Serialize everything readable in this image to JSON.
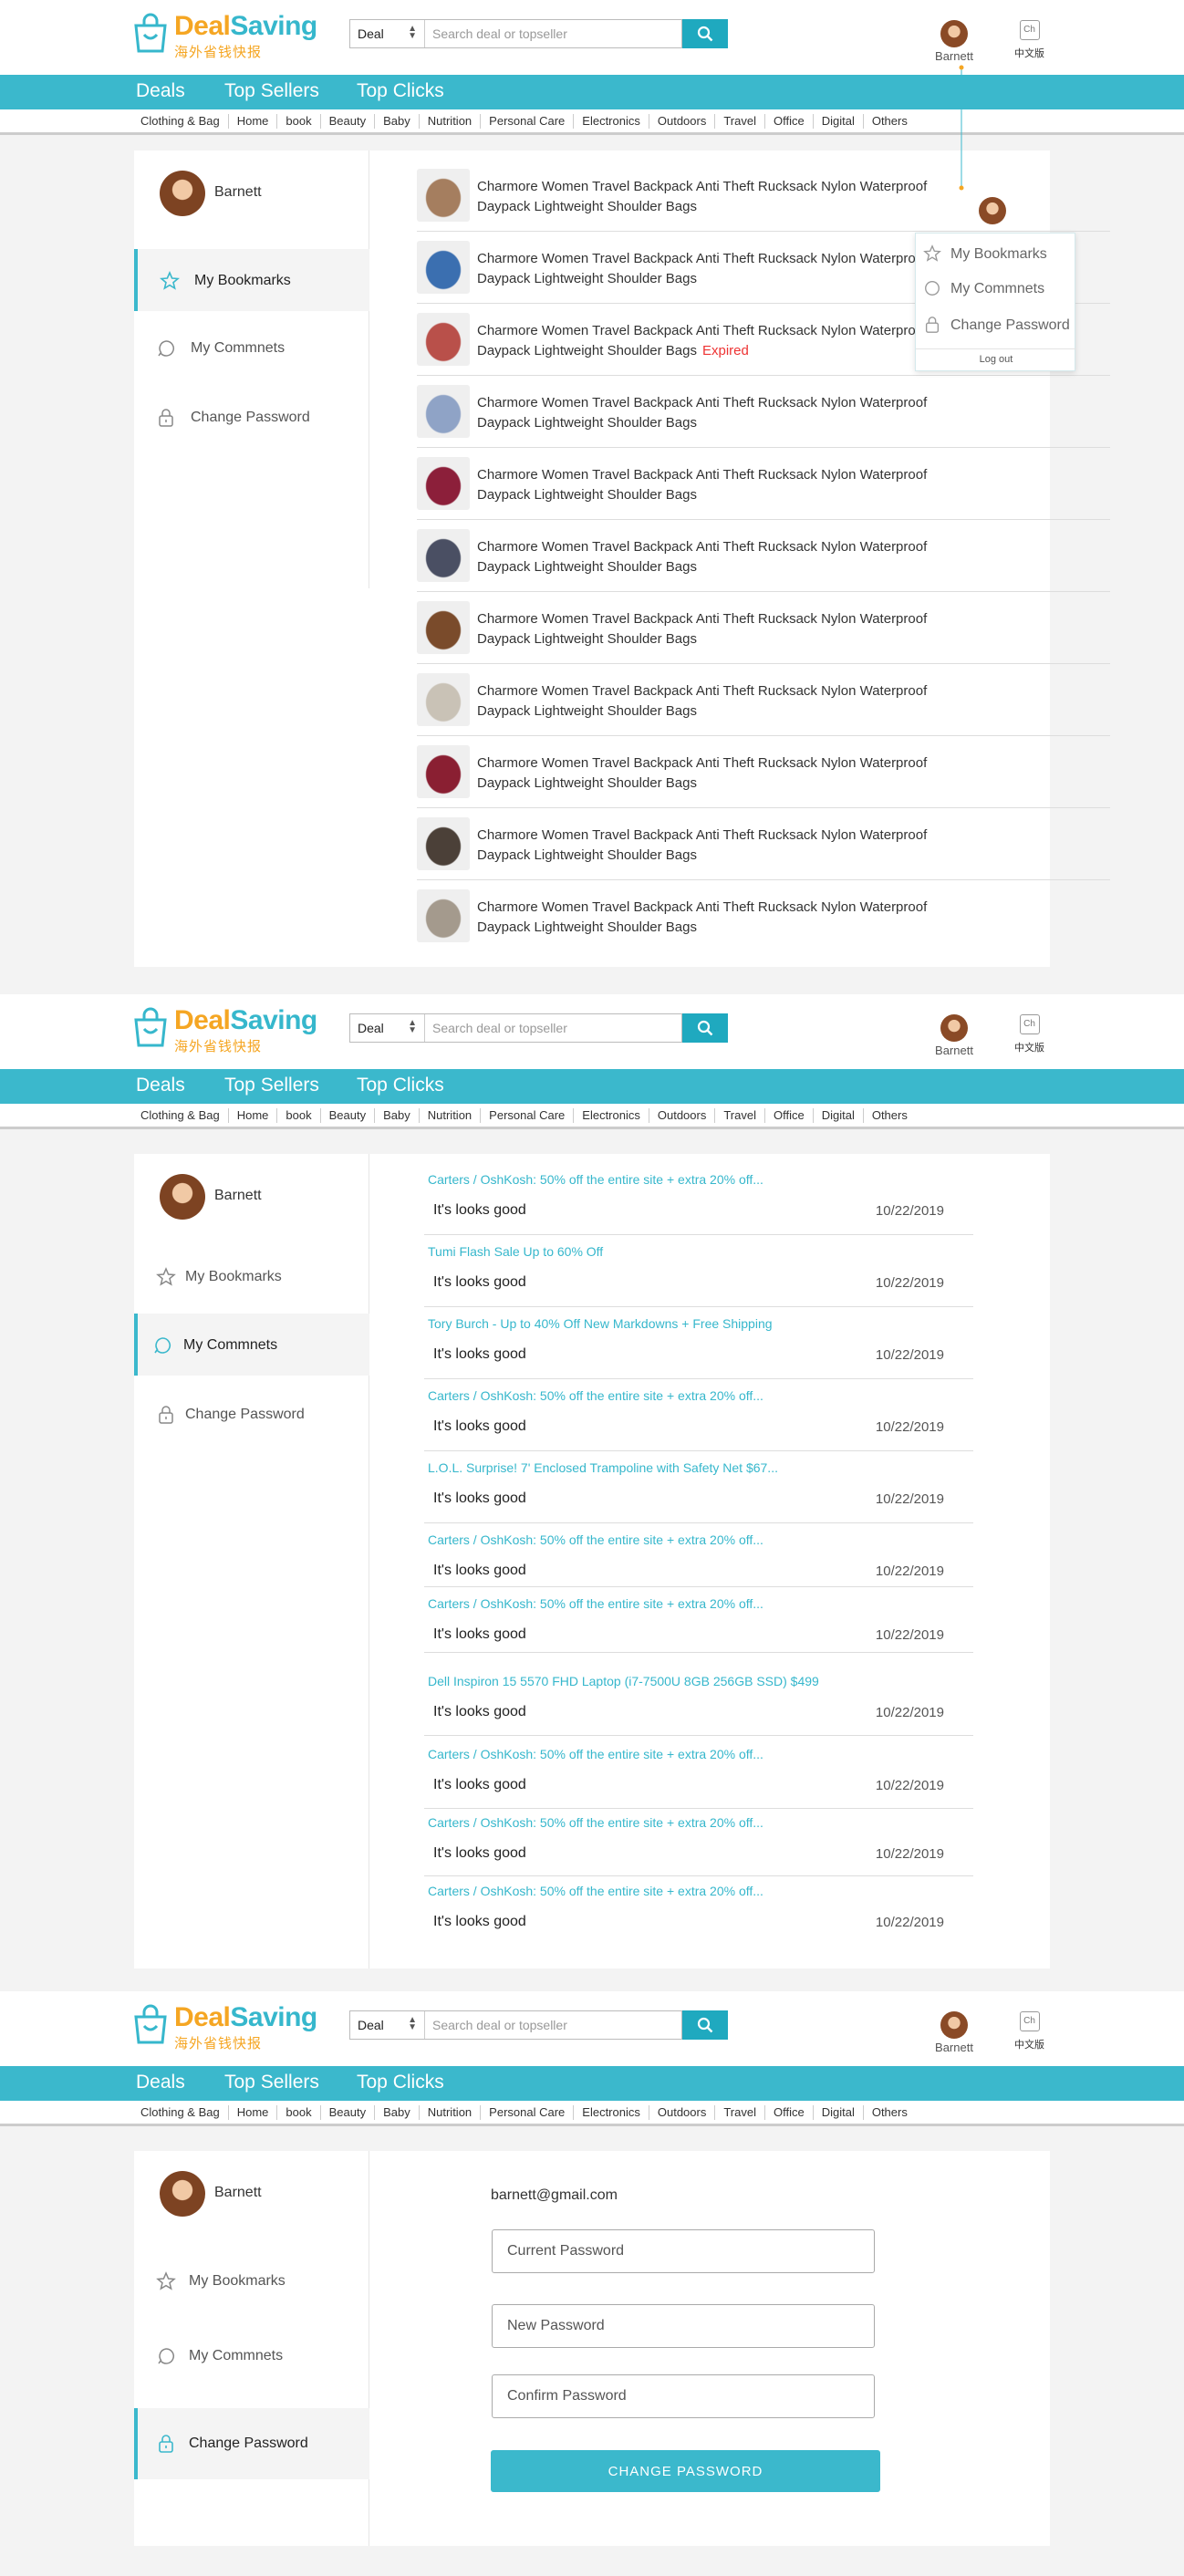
{
  "header": {
    "brand_part1": "Deal",
    "brand_part2": "Saving",
    "brand_sub": "海外省钱快报",
    "search_select": "Deal",
    "search_placeholder": "Search deal or topseller",
    "user_name": "Barnett",
    "lang_icon": "Ch",
    "lang_label": "中文版",
    "icons": {
      "search": "search-icon",
      "bag": "shopping-bag-icon"
    }
  },
  "nav": [
    "Deals",
    "Top Sellers",
    "Top Clicks"
  ],
  "categories": [
    "Clothing & Bag",
    "Home",
    "book",
    "Beauty",
    "Baby",
    "Nutrition",
    "Personal Care",
    "Electronics",
    "Outdoors",
    "Travel",
    "Office",
    "Digital",
    "Others"
  ],
  "sidebar": {
    "user": "Barnett",
    "items": [
      "My Bookmarks",
      "My Commnets",
      "Change Password"
    ]
  },
  "bookmarks": {
    "items": [
      {
        "title": "Charmore Women Travel Backpack Anti Theft Rucksack Nylon Waterproof Daypack Lightweight Shoulder Bags",
        "expired": "",
        "color": "#a57e5f"
      },
      {
        "title": "Charmore Women Travel Backpack Anti Theft Rucksack Nylon Waterproof Daypack Lightweight Shoulder Bags",
        "expired": "",
        "color": "#3b6fb0"
      },
      {
        "title": "Charmore Women Travel Backpack Anti Theft Rucksack Nylon Waterproof Daypack Lightweight Shoulder Bags",
        "expired": "Expired",
        "color": "#b9504a"
      },
      {
        "title": "Charmore Women Travel Backpack Anti Theft Rucksack Nylon Waterproof Daypack Lightweight Shoulder Bags",
        "expired": "",
        "color": "#8fa3c6"
      },
      {
        "title": "Charmore Women Travel Backpack Anti Theft Rucksack Nylon Waterproof Daypack Lightweight Shoulder Bags",
        "expired": "",
        "color": "#8c1f3a"
      },
      {
        "title": "Charmore Women Travel Backpack Anti Theft Rucksack Nylon Waterproof Daypack Lightweight Shoulder Bags",
        "expired": "",
        "color": "#4a4f63"
      },
      {
        "title": "Charmore Women Travel Backpack Anti Theft Rucksack Nylon Waterproof Daypack Lightweight Shoulder Bags",
        "expired": "",
        "color": "#7a4b2b"
      },
      {
        "title": "Charmore Women Travel Backpack Anti Theft Rucksack Nylon Waterproof Daypack Lightweight Shoulder Bags",
        "expired": "",
        "color": "#c9c2b6"
      },
      {
        "title": "Charmore Women Travel Backpack Anti Theft Rucksack Nylon Waterproof Daypack Lightweight Shoulder Bags",
        "expired": "",
        "color": "#8a1f32"
      },
      {
        "title": "Charmore Women Travel Backpack Anti Theft Rucksack Nylon Waterproof Daypack Lightweight Shoulder Bags",
        "expired": "",
        "color": "#4b4038"
      },
      {
        "title": "Charmore Women Travel Backpack Anti Theft Rucksack Nylon Waterproof Daypack Lightweight Shoulder Bags",
        "expired": "",
        "color": "#a49a8d"
      }
    ]
  },
  "dropdown": {
    "items": [
      "My Bookmarks",
      "My Commnets",
      "Change Password"
    ],
    "logout": "Log out"
  },
  "comments": {
    "items": [
      {
        "title": "Carters / OshKosh: 50% off the entire site + extra 20% off...",
        "text": "It's looks good",
        "date": "10/22/2019"
      },
      {
        "title": "Tumi Flash Sale Up to 60% Off",
        "text": "It's looks good",
        "date": "10/22/2019"
      },
      {
        "title": "Tory Burch - Up to 40% Off New Markdowns + Free Shipping",
        "text": "It's looks good",
        "date": "10/22/2019"
      },
      {
        "title": "Carters / OshKosh: 50% off the entire site + extra 20% off...",
        "text": "It's looks good",
        "date": "10/22/2019"
      },
      {
        "title": "L.O.L. Surprise! 7' Enclosed Trampoline with Safety Net $67...",
        "text": "It's looks good",
        "date": "10/22/2019"
      },
      {
        "title": "Carters / OshKosh: 50% off the entire site + extra 20% off...",
        "text": "It's looks good",
        "date": "10/22/2019"
      },
      {
        "title": "Carters / OshKosh: 50% off the entire site + extra 20% off...",
        "text": "It's looks good",
        "date": "10/22/2019"
      },
      {
        "title": "Dell Inspiron 15 5570 FHD Laptop (i7-7500U 8GB 256GB SSD) $499",
        "text": "It's looks good",
        "date": "10/22/2019"
      },
      {
        "title": "Carters / OshKosh: 50% off the entire site + extra 20% off...",
        "text": "It's looks good",
        "date": "10/22/2019"
      },
      {
        "title": "Carters / OshKosh: 50% off the entire site + extra 20% off...",
        "text": "It's looks good",
        "date": "10/22/2019"
      },
      {
        "title": "Carters / OshKosh: 50% off the entire site + extra 20% off...",
        "text": "It's looks good",
        "date": "10/22/2019"
      }
    ]
  },
  "password": {
    "email": "barnett@gmail.com",
    "current_placeholder": "Current Password",
    "new_placeholder": "New Password",
    "confirm_placeholder": "Confirm Password",
    "button": "CHANGE PASSWORD"
  },
  "colors": {
    "accent": "#3bb8cc",
    "brand_orange": "#f5a623",
    "expired": "#e33"
  }
}
